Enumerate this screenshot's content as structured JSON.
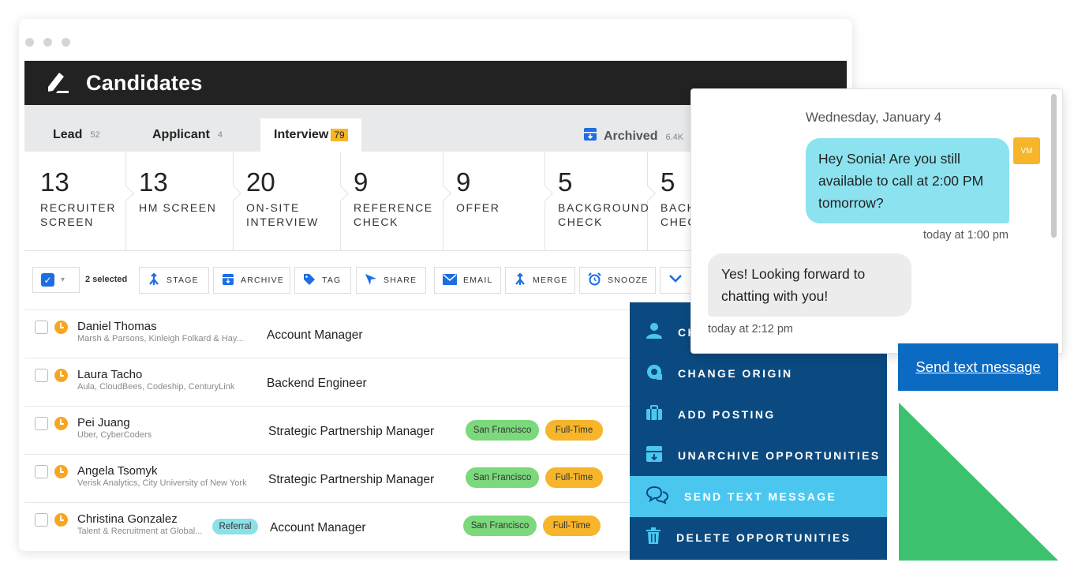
{
  "app": {
    "title": "Candidates"
  },
  "tabs": [
    {
      "label": "Lead",
      "count": "52"
    },
    {
      "label": "Applicant",
      "count": "4"
    },
    {
      "label": "Interview",
      "count": "79"
    }
  ],
  "archived": {
    "label": "Archived",
    "count": "6.4K"
  },
  "stages": [
    {
      "count": "13",
      "name": "RECRUITER\nSCREEN"
    },
    {
      "count": "13",
      "name": "HM SCREEN"
    },
    {
      "count": "20",
      "name": "ON-SITE\nINTERVIEW"
    },
    {
      "count": "9",
      "name": "REFERENCE\nCHECK"
    },
    {
      "count": "9",
      "name": "OFFER"
    },
    {
      "count": "5",
      "name": "BACKGROUND\nCHECK"
    },
    {
      "count": "5",
      "name": "BACK\nCHEC"
    }
  ],
  "toolbar": {
    "selected": "2 selected",
    "buttons": [
      "STAGE",
      "ARCHIVE",
      "TAG",
      "SHARE",
      "EMAIL",
      "MERGE",
      "SNOOZE"
    ]
  },
  "candidates": [
    {
      "name": "Daniel Thomas",
      "companies": "Marsh & Parsons, Kinleigh Folkard & Hay...",
      "role": "Account Manager",
      "location": "",
      "type": "",
      "referral": ""
    },
    {
      "name": "Laura Tacho",
      "companies": "Aula, CloudBees, Codeship, CenturyLink",
      "role": "Backend Engineer",
      "location": "",
      "type": "",
      "referral": ""
    },
    {
      "name": "Pei Juang",
      "companies": "Uber, CyberCoders",
      "role": "Strategic Partnership Manager",
      "location": "San Francisco",
      "type": "Full-Time",
      "referral": ""
    },
    {
      "name": "Angela Tsomyk",
      "companies": "Verisk Analytics, City University of New York",
      "role": "Strategic Partnership Manager",
      "location": "San Francisco",
      "type": "Full-Time",
      "referral": ""
    },
    {
      "name": "Christina Gonzalez",
      "companies": "Talent & Recruitment at Global...",
      "role": "Account Manager",
      "location": "San Francisco",
      "type": "Full-Time",
      "referral": "Referral"
    }
  ],
  "menu": {
    "items": [
      {
        "label": "CH",
        "icon": "user-icon"
      },
      {
        "label": "CHANGE ORIGIN",
        "icon": "origin-icon"
      },
      {
        "label": "ADD POSTING",
        "icon": "briefcase-icon"
      },
      {
        "label": "UNARCHIVE OPPORTUNITIES",
        "icon": "unarchive-icon"
      },
      {
        "label": "SEND TEXT MESSAGE",
        "icon": "chat-icon"
      },
      {
        "label": "DELETE OPPORTUNITIES",
        "icon": "trash-icon"
      }
    ]
  },
  "chat": {
    "date": "Wednesday, January 4",
    "outgoing": "Hey Sonia! Are you still available to call at 2:00 PM tomorrow?",
    "outgoing_time": "today at 1:00 pm",
    "avatar": "VM",
    "incoming": "Yes! Looking forward to chatting with you!",
    "incoming_time": "today at 2:12 pm"
  },
  "send_button": "Send text message",
  "colors": {
    "appbar": "#222222",
    "menu": "#0b4a80",
    "menu_highlight": "#4bc7ef",
    "outgoing_bubble": "#8ce3ef",
    "send_button": "#0b6ac2",
    "accent_green": "#3cc26e",
    "badge": "#f6b52a"
  }
}
